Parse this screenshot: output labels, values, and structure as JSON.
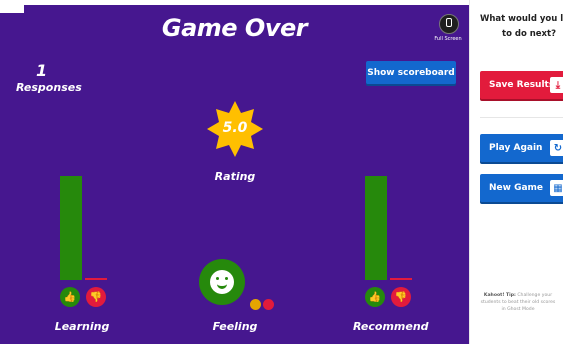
{
  "header": {
    "title": "Game Over",
    "fullscreen_label": "Full Screen"
  },
  "stats": {
    "responses_count": "1",
    "responses_label": "Responses",
    "scoreboard_button": "Show scoreboard",
    "rating_value": "5.0",
    "rating_label": "Rating"
  },
  "groups": {
    "learning": {
      "label": "Learning",
      "positive": 1,
      "negative": 0
    },
    "feeling": {
      "label": "Feeling"
    },
    "recommend": {
      "label": "Recommend",
      "positive": 1,
      "negative": 0
    }
  },
  "sidebar": {
    "question_line1": "What would you like",
    "question_line2": "to do next?",
    "save_results": "Save Results",
    "play_again": "Play Again",
    "new_game": "New Game",
    "tip_title": "Kahoot! Tip:",
    "tip_text": "Challenge your students to beat their old scores in Ghost Mode"
  },
  "colors": {
    "background": "#46178f",
    "green": "#26890c",
    "red": "#e21b3c",
    "blue": "#1368ce",
    "star": "#ffbf00"
  },
  "icons": [
    "fullscreen-icon",
    "star-badge",
    "thumbs-up-icon",
    "thumbs-down-icon",
    "smiley-face-icon",
    "download-icon",
    "replay-icon",
    "grid-icon"
  ]
}
